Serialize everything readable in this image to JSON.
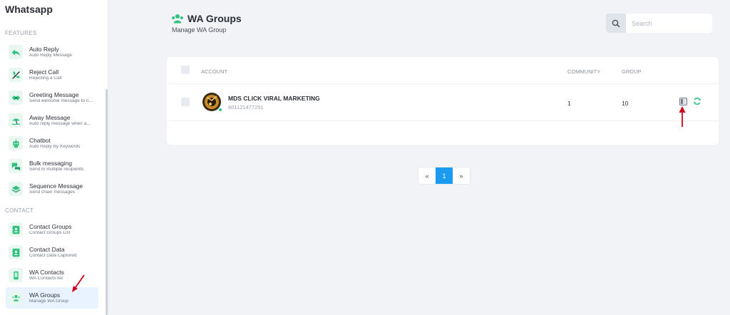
{
  "sidebar": {
    "brand": "Whatsapp",
    "sections": {
      "features": "FEATURES",
      "contact": "CONTACT"
    },
    "items": [
      {
        "title": "Auto Reply",
        "subtitle": "Auto Reply Message",
        "icon": "reply-icon"
      },
      {
        "title": "Reject Call",
        "subtitle": "Rejecting a Call",
        "icon": "phone-off-icon"
      },
      {
        "title": "Greeting Message",
        "subtitle": "Send welcome message to n...",
        "icon": "handshake-icon"
      },
      {
        "title": "Away Message",
        "subtitle": "Auto reply message when a...",
        "icon": "beach-icon"
      },
      {
        "title": "Chatbot",
        "subtitle": "Auto Reply By Keywords",
        "icon": "robot-icon"
      },
      {
        "title": "Bulk messaging",
        "subtitle": "Send to multiple recipients",
        "icon": "chat-bubbles-icon"
      },
      {
        "title": "Sequence Message",
        "subtitle": "Send chain messages",
        "icon": "layers-icon"
      },
      {
        "title": "Contact Groups",
        "subtitle": "Contact Groups List",
        "icon": "contact-card-icon"
      },
      {
        "title": "Contact Data",
        "subtitle": "Contact Data Captured",
        "icon": "contact-card-icon"
      },
      {
        "title": "WA Contacts",
        "subtitle": "WA Contacts list",
        "icon": "phone-icon"
      },
      {
        "title": "WA Groups",
        "subtitle": "Manage WA Group",
        "icon": "users-icon",
        "active": true
      }
    ]
  },
  "header": {
    "title": "WA Groups",
    "subtitle": "Manage WA Group",
    "search_placeholder": "Search"
  },
  "table": {
    "columns": [
      "ACCOUNT",
      "COMMUNITY",
      "GROUP"
    ],
    "rows": [
      {
        "name": "MDS CLICK VIRAL MARKETING",
        "phone": "601121477251",
        "community": "1",
        "group": "10",
        "status": "online"
      }
    ]
  },
  "pagination": {
    "prev": "«",
    "current": "1",
    "next": "»"
  },
  "colors": {
    "accent": "#1a9af0",
    "green": "#23c78d",
    "annotation": "#d0021b"
  }
}
